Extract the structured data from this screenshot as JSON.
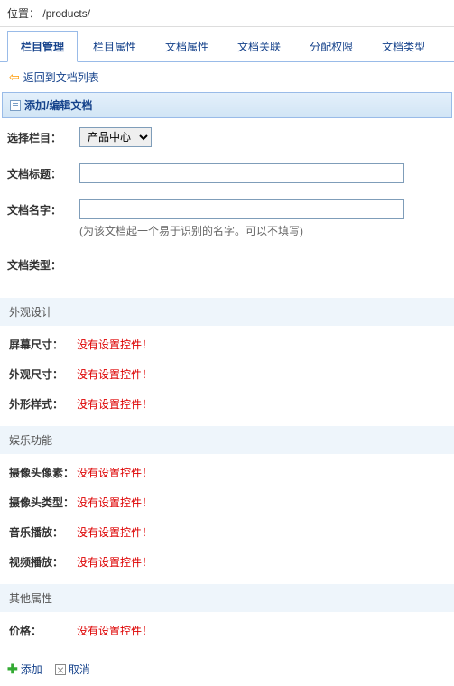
{
  "location": {
    "label": "位置：",
    "path": "/products/"
  },
  "tabs": [
    {
      "label": "栏目管理",
      "active": true
    },
    {
      "label": "栏目属性",
      "active": false
    },
    {
      "label": "文档属性",
      "active": false
    },
    {
      "label": "文档关联",
      "active": false
    },
    {
      "label": "分配权限",
      "active": false
    },
    {
      "label": "文档类型",
      "active": false
    }
  ],
  "back_link": "返回到文档列表",
  "panel_title": "添加/编辑文档",
  "form": {
    "select_column": {
      "label": "选择栏目：",
      "value": "产品中心"
    },
    "doc_title": {
      "label": "文档标题：",
      "value": ""
    },
    "doc_name": {
      "label": "文档名字：",
      "value": "",
      "hint": "(为该文档起一个易于识别的名字。可以不填写)"
    },
    "doc_type": {
      "label": "文档类型："
    }
  },
  "sections": [
    {
      "title": "外观设计",
      "attrs": [
        {
          "label": "屏幕尺寸：",
          "value": "没有设置控件！"
        },
        {
          "label": "外观尺寸：",
          "value": "没有设置控件！"
        },
        {
          "label": "外形样式：",
          "value": "没有设置控件！"
        }
      ]
    },
    {
      "title": "娱乐功能",
      "attrs": [
        {
          "label": "摄像头像素：",
          "value": "没有设置控件！"
        },
        {
          "label": "摄像头类型：",
          "value": "没有设置控件！"
        },
        {
          "label": "音乐播放：",
          "value": "没有设置控件！"
        },
        {
          "label": "视频播放：",
          "value": "没有设置控件！"
        }
      ]
    },
    {
      "title": "其他属性",
      "attrs": [
        {
          "label": "价格：",
          "value": "没有设置控件！"
        }
      ]
    }
  ],
  "actions": {
    "add": "添加",
    "cancel": "取消"
  }
}
